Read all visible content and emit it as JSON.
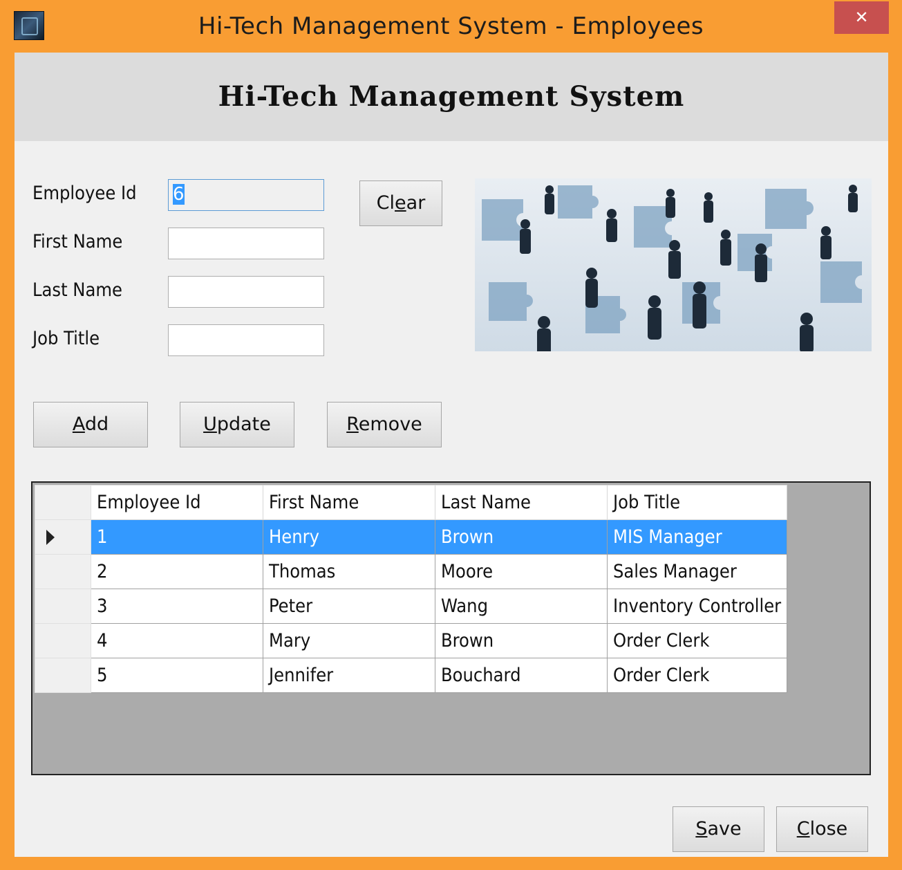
{
  "window": {
    "title": "Hi-Tech Management System - Employees",
    "close_glyph": "✕"
  },
  "banner": {
    "title": "Hi-Tech Management System"
  },
  "form": {
    "employee_id_label": "Employee Id",
    "employee_id_value": "6",
    "first_name_label": "First Name",
    "first_name_value": "",
    "last_name_label": "Last Name",
    "last_name_value": "",
    "job_title_label": "Job Title",
    "job_title_value": ""
  },
  "buttons": {
    "clear": {
      "pre": "Cl",
      "ul": "e",
      "post": "ar"
    },
    "add": {
      "pre": "",
      "ul": "A",
      "post": "dd"
    },
    "update": {
      "pre": "",
      "ul": "U",
      "post": "pdate"
    },
    "remove": {
      "pre": "",
      "ul": "R",
      "post": "emove"
    },
    "save": {
      "pre": "",
      "ul": "S",
      "post": "ave"
    },
    "close": {
      "pre": "",
      "ul": "C",
      "post": "lose"
    }
  },
  "table": {
    "columns": [
      "Employee Id",
      "First Name",
      "Last Name",
      "Job Title"
    ],
    "rows": [
      [
        "1",
        "Henry",
        "Brown",
        "MIS Manager"
      ],
      [
        "2",
        "Thomas",
        "Moore",
        "Sales Manager"
      ],
      [
        "3",
        "Peter",
        "Wang",
        "Inventory Controller"
      ],
      [
        "4",
        "Mary",
        "Brown",
        "Order Clerk"
      ],
      [
        "5",
        "Jennifer",
        "Bouchard",
        "Order Clerk"
      ]
    ],
    "selected_row": 0
  },
  "colors": {
    "window_frame": "#f99d33",
    "close_button": "#c7504f",
    "selection": "#3399ff"
  }
}
